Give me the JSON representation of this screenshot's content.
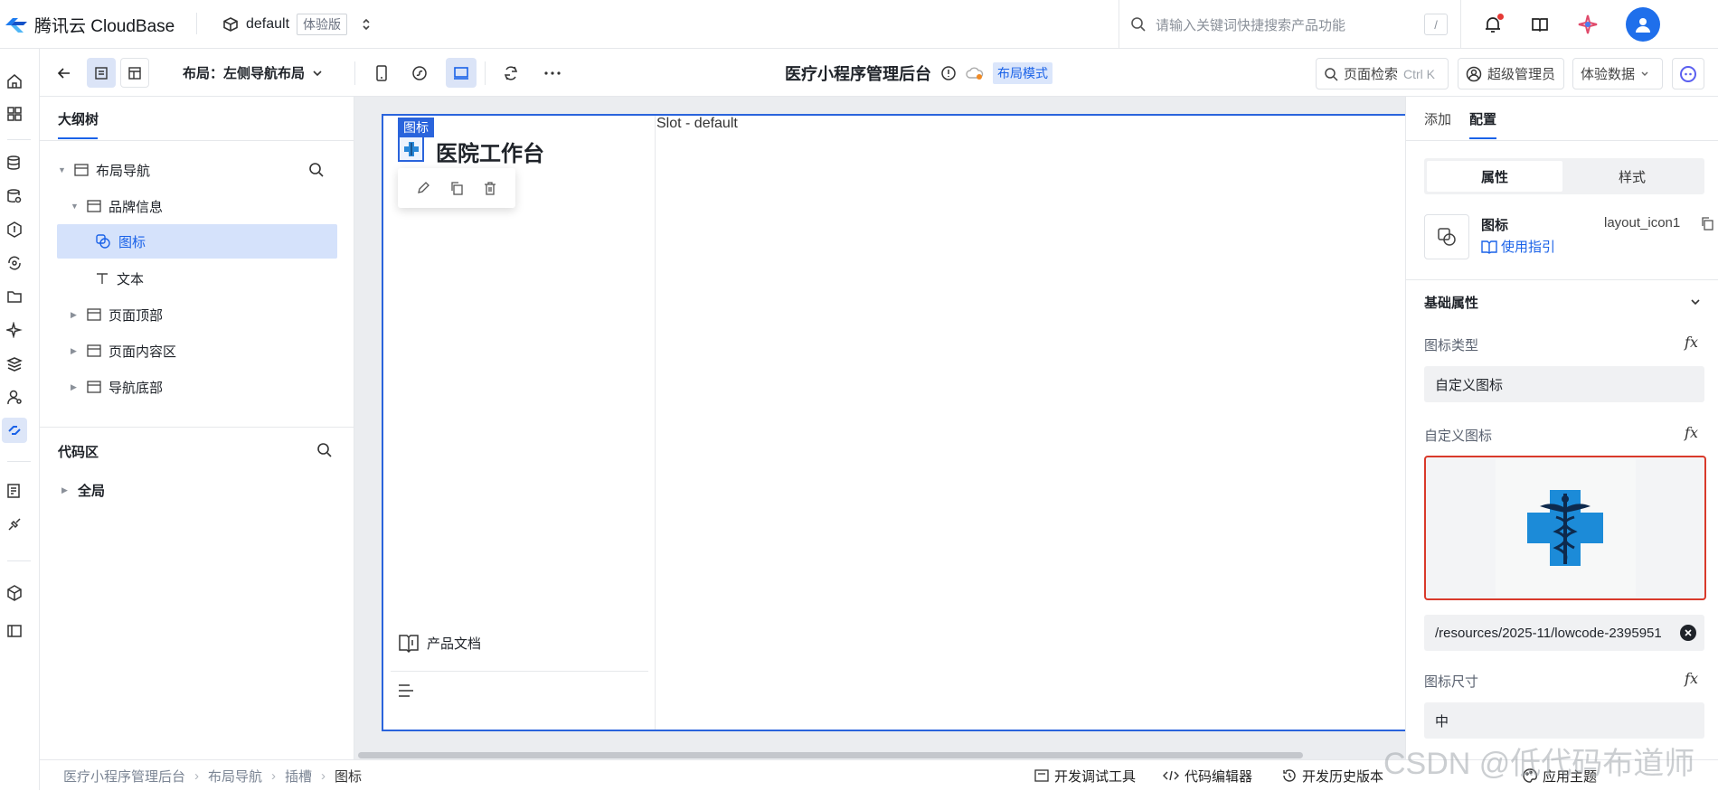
{
  "topbar": {
    "brand": "腾讯云 CloudBase",
    "env_name": "default",
    "env_badge": "体验版",
    "search_placeholder": "请输入关键词快捷搜索产品功能",
    "search_shortcut": "/"
  },
  "toolbar": {
    "layout_label": "布局：左侧导航布局",
    "page_title": "医疗小程序管理后台",
    "mode_tag": "布局模式",
    "page_search": "页面检索",
    "page_search_shortcut": "Ctrl K",
    "role": "超级管理员",
    "data_source": "体验数据"
  },
  "outline": {
    "tab_label": "大纲树",
    "tree": [
      {
        "label": "布局导航"
      },
      {
        "label": "品牌信息"
      },
      {
        "label": "图标"
      },
      {
        "label": "文本"
      },
      {
        "label": "页面顶部"
      },
      {
        "label": "页面内容区"
      },
      {
        "label": "导航底部"
      }
    ],
    "code_title": "代码区",
    "code_global": "全局"
  },
  "canvas": {
    "selection_tag": "图标",
    "brand_title": "医院工作台",
    "slot_label": "Slot - default",
    "doc_link": "产品文档"
  },
  "right_panel": {
    "tab_add": "添加",
    "tab_config": "配置",
    "seg_props": "属性",
    "seg_style": "样式",
    "component_name": "图标",
    "component_id": "layout_icon1",
    "guide_link": "使用指引",
    "section_basic": "基础属性",
    "icon_type_label": "图标类型",
    "icon_type_value": "自定义图标",
    "custom_icon_label": "自定义图标",
    "icon_path": "/resources/2025-11/lowcode-2395951",
    "icon_size_label": "图标尺寸",
    "icon_size_value": "中"
  },
  "breadcrumb": [
    "医疗小程序管理后台",
    "布局导航",
    "插槽",
    "图标"
  ],
  "bottom_tools": {
    "debug": "开发调试工具",
    "code_editor": "代码编辑器",
    "history": "开发历史版本",
    "theme": "应用主题"
  },
  "watermark": "CSDN @低代码布道师",
  "colors": {
    "accent": "#1a62e8",
    "selection": "#2a64dc",
    "danger_border": "#d93a2b"
  }
}
